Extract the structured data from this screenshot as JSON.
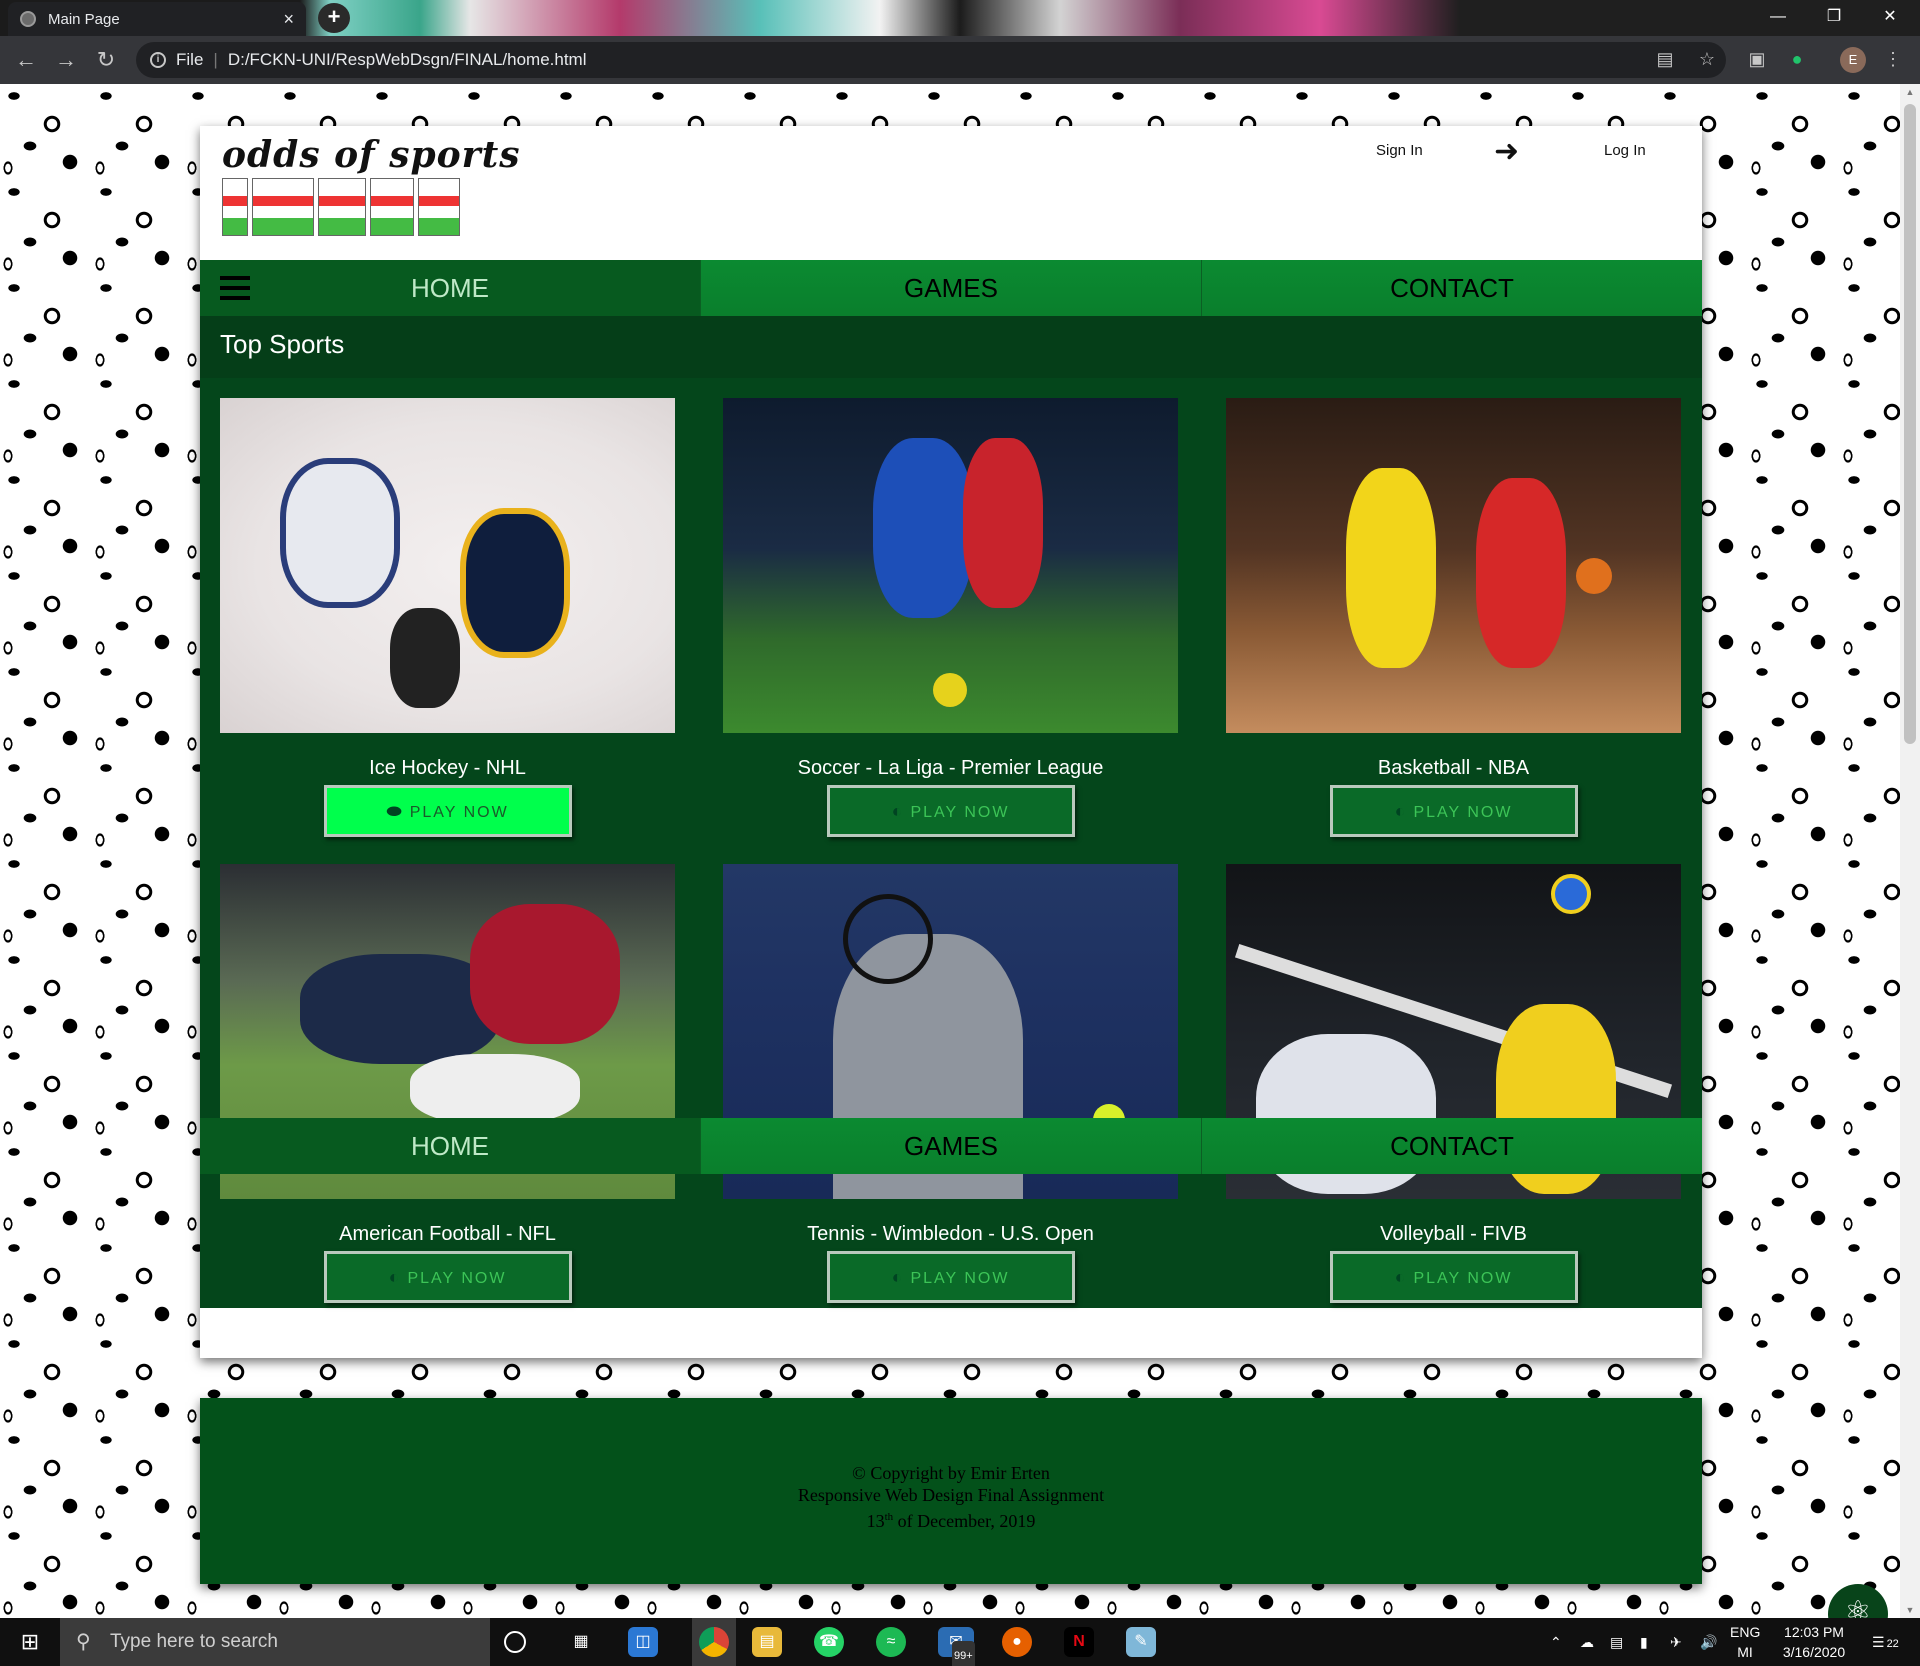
{
  "browser": {
    "tab_title": "Main Page",
    "tab_close": "×",
    "new_tab": "+",
    "address_prefix": "File",
    "address": "D:/FCKN-UNI/RespWebDsgn/FINAL/home.html",
    "profile_initial": "E"
  },
  "site": {
    "logo": "odds of sports",
    "sign_in": "Sign In",
    "log_in": "Log In",
    "nav": [
      "HOME",
      "GAMES",
      "CONTACT"
    ],
    "section_title": "Top Sports",
    "sports": [
      {
        "caption": "Ice Hockey - NHL",
        "button": "PLAY NOW",
        "icon": "hockey-puck-icon"
      },
      {
        "caption": "Soccer - La Liga - Premier League",
        "button": "PLAY NOW",
        "icon": "gauge-icon"
      },
      {
        "caption": "Basketball - NBA",
        "button": "PLAY NOW",
        "icon": "gauge-icon"
      },
      {
        "caption": "American Football - NFL",
        "button": "PLAY NOW",
        "icon": "gauge-icon"
      },
      {
        "caption": "Tennis - Wimbledon - U.S. Open",
        "button": "PLAY NOW",
        "icon": "gauge-icon"
      },
      {
        "caption": "Volleyball - FIVB",
        "button": "PLAY NOW",
        "icon": "gauge-icon"
      }
    ],
    "footer": {
      "line1": "© Copyright by Emir Erten",
      "line2": "Responsive Web Design Final Assignment",
      "line3_day": "13",
      "line3_suffix": "th",
      "line3_rest": " of December, 2019"
    }
  },
  "taskbar": {
    "search_placeholder": "Type here to search",
    "mail_badge": "99+",
    "lang_top": "ENG",
    "lang_bottom": "MI",
    "time": "12:03 PM",
    "date": "3/16/2020",
    "notification_count": "22"
  },
  "colors": {
    "nav_green": "#0b8a31",
    "nav_active": "#075a1f",
    "content_bg": "#04461b",
    "button_active": "#00ff4c"
  }
}
